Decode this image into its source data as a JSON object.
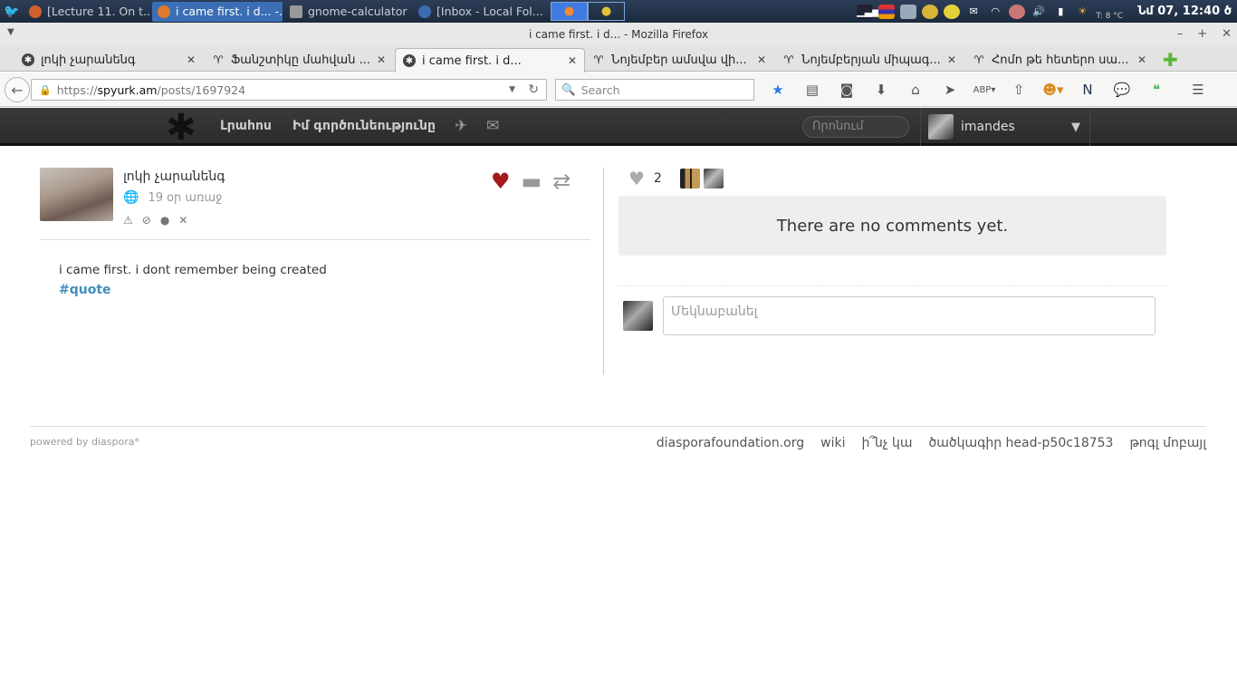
{
  "os_panel": {
    "tasks": [
      {
        "label": "[Lecture 11. On t...",
        "active": false,
        "icon": "firefox-icon"
      },
      {
        "label": "i came first. i d... -...",
        "active": true,
        "icon": "firefox-icon"
      },
      {
        "label": "gnome-calculator",
        "active": false,
        "icon": "calculator-icon"
      },
      {
        "label": "[Inbox - Local Fol...",
        "active": false,
        "icon": "thunderbird-icon"
      }
    ],
    "clock": "Նմ 07, 12:40 ծ",
    "temp": "T: 8 °C"
  },
  "window": {
    "title": "i came first. i d... - Mozilla Firefox"
  },
  "tabs": [
    {
      "label": "լոկի չարանենգ",
      "selected": false
    },
    {
      "label": "Ֆանշտիկը մահվան ...",
      "selected": false
    },
    {
      "label": "i came first. i d...",
      "selected": true
    },
    {
      "label": "Նոյեմբեր ամսվա վի...",
      "selected": false
    },
    {
      "label": "Նոյեմբերյան միպագ...",
      "selected": false
    },
    {
      "label": "Հոմո թե հետերո սա...",
      "selected": false
    }
  ],
  "navbar": {
    "url_prefix": "https://",
    "url_domain": "spyurk.am",
    "url_path": "/posts/1697924",
    "search_placeholder": "Search"
  },
  "site_header": {
    "nav_stream": "Լրահոս",
    "nav_activity": "Իմ գործունեությունը",
    "search_placeholder": "Որոնում",
    "username": "imandes"
  },
  "post": {
    "author": "լոկի չարանենգ",
    "time": "19 օր առաջ",
    "text": "i came first. i dont remember being created",
    "tag": "#quote"
  },
  "comments": {
    "like_count": "2",
    "empty_message": "There are no comments yet.",
    "input_placeholder": "Մեկնաբանել"
  },
  "footer": {
    "powered_by": "powered by diaspora*",
    "links": [
      "diasporafoundation.org",
      "wiki",
      "ի՞նչ կա",
      "ծածկագիր head-p50c18753",
      "թոգլ մոբայլ"
    ]
  }
}
